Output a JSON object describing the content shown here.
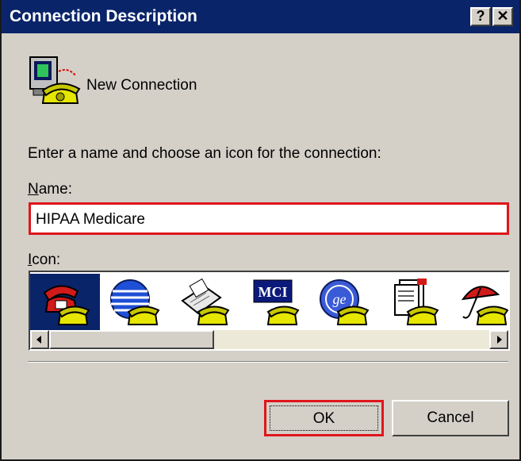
{
  "window": {
    "title": "Connection Description",
    "help_glyph": "?",
    "close_glyph": "✕"
  },
  "connection": {
    "name": "New Connection",
    "icon": "phone-computer-icon"
  },
  "instructions": "Enter a name and choose an icon for the connection:",
  "name_field": {
    "label": "Name:",
    "value": "HIPAA Medicare"
  },
  "icon_field": {
    "label": "Icon:",
    "icons": [
      {
        "name": "red-phone-icon",
        "selected": true
      },
      {
        "name": "globe-icon",
        "selected": false
      },
      {
        "name": "fax-icon",
        "selected": false
      },
      {
        "name": "mci-icon",
        "selected": false
      },
      {
        "name": "ge-icon",
        "selected": false
      },
      {
        "name": "documents-icon",
        "selected": false
      },
      {
        "name": "umbrella-icon",
        "selected": false
      }
    ]
  },
  "buttons": {
    "ok_label": "OK",
    "cancel_label": "Cancel"
  },
  "colors": {
    "titlebar": "#0a246a",
    "dialog_bg": "#d4d0c8",
    "highlight": "#e0151b"
  }
}
